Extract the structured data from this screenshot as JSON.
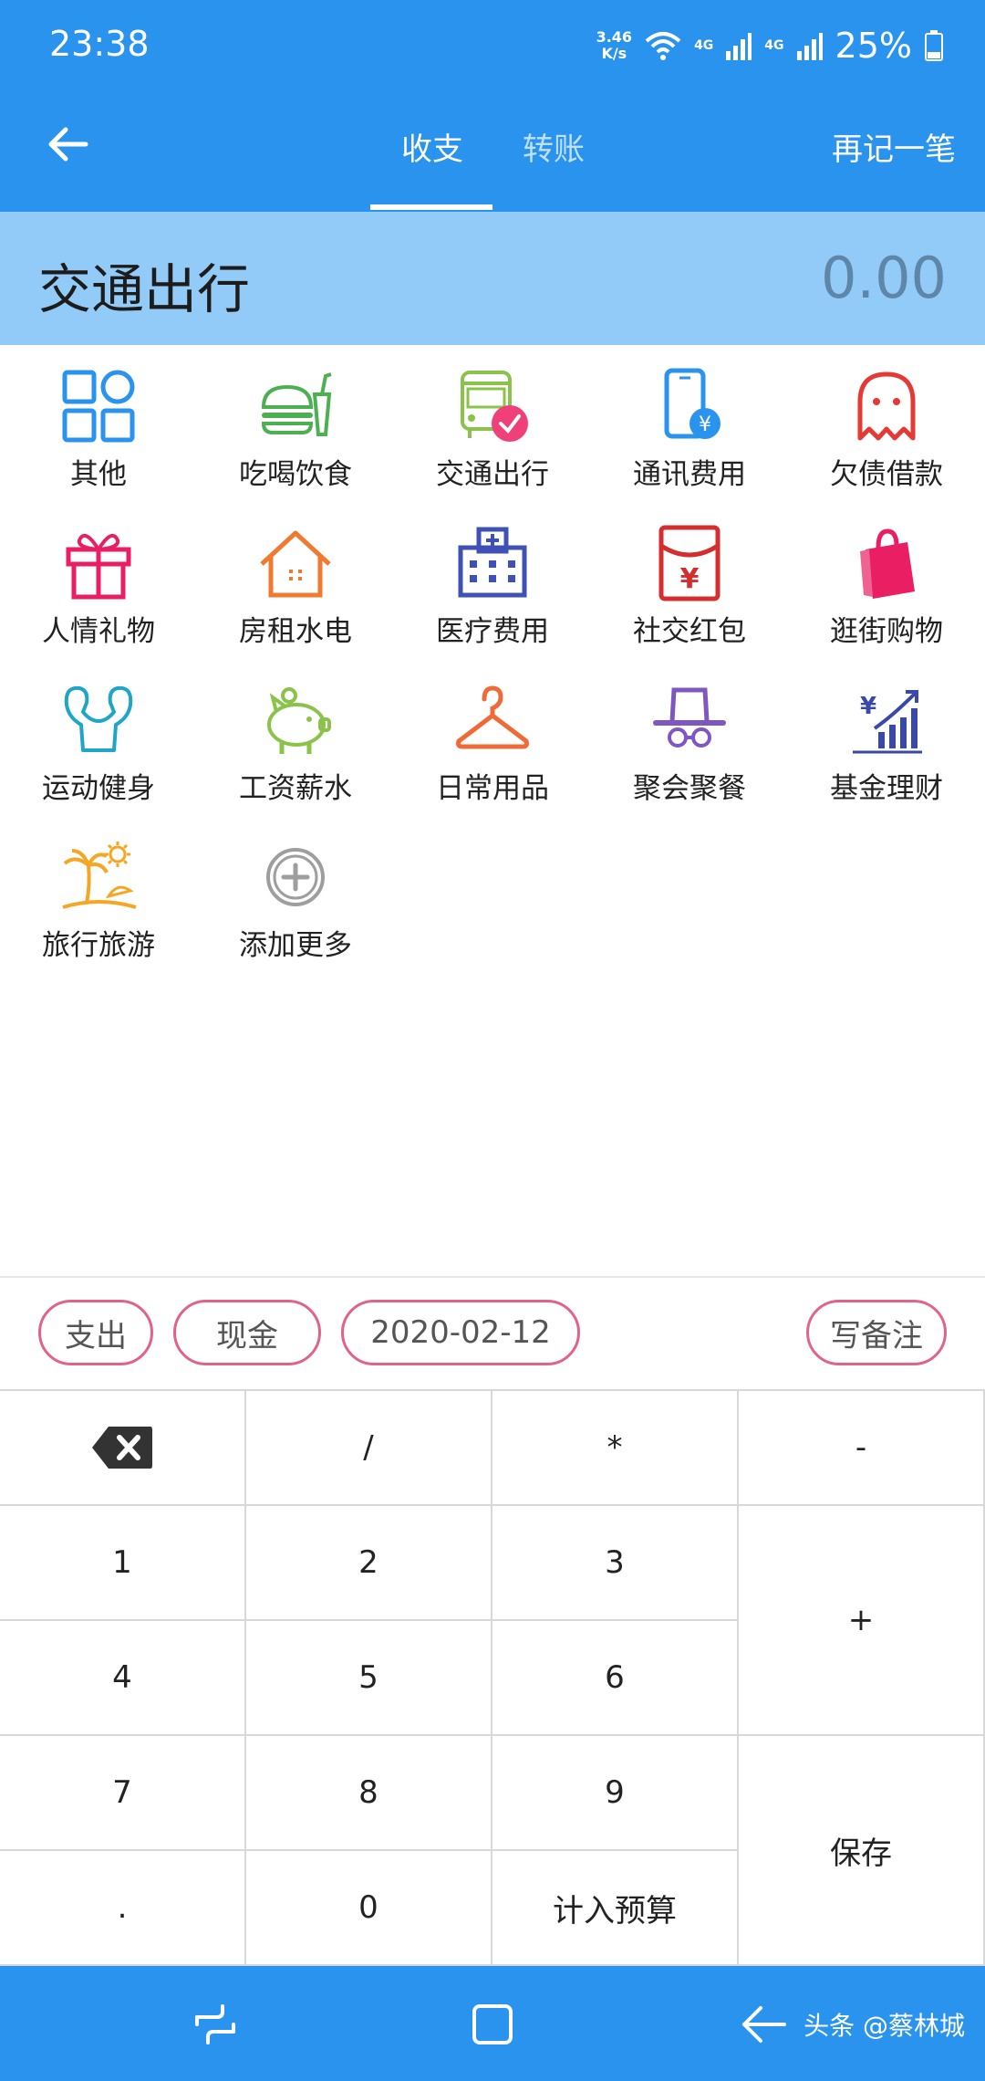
{
  "status": {
    "time": "23:38",
    "speed_top": "3.46",
    "speed_bottom": "K/s",
    "net1": "4G",
    "net2": "4G",
    "battery": "25%"
  },
  "appbar": {
    "tab_income_expense": "收支",
    "tab_transfer": "转账",
    "again": "再记一笔"
  },
  "category_bar": {
    "name": "交通出行",
    "amount": "0.00"
  },
  "categories": [
    {
      "label": "其他",
      "icon": "grid-icon"
    },
    {
      "label": "吃喝饮食",
      "icon": "burger-drink-icon"
    },
    {
      "label": "交通出行",
      "icon": "bus-icon"
    },
    {
      "label": "通讯费用",
      "icon": "phone-icon"
    },
    {
      "label": "欠债借款",
      "icon": "ghost-icon"
    },
    {
      "label": "人情礼物",
      "icon": "gift-icon"
    },
    {
      "label": "房租水电",
      "icon": "house-icon"
    },
    {
      "label": "医疗费用",
      "icon": "hospital-icon"
    },
    {
      "label": "社交红包",
      "icon": "red-envelope-icon"
    },
    {
      "label": "逛街购物",
      "icon": "shopping-bag-icon"
    },
    {
      "label": "运动健身",
      "icon": "muscle-icon"
    },
    {
      "label": "工资薪水",
      "icon": "piggy-bank-icon"
    },
    {
      "label": "日常用品",
      "icon": "hanger-icon"
    },
    {
      "label": "聚会聚餐",
      "icon": "hat-glasses-icon"
    },
    {
      "label": "基金理财",
      "icon": "finance-chart-icon"
    },
    {
      "label": "旅行旅游",
      "icon": "beach-icon"
    },
    {
      "label": "添加更多",
      "icon": "add-circle-icon"
    }
  ],
  "chips": {
    "type": "支出",
    "account": "现金",
    "date": "2020-02-12",
    "note": "写备注"
  },
  "keys": {
    "slash": "/",
    "star": "*",
    "minus": "-",
    "k1": "1",
    "k2": "2",
    "k3": "3",
    "plus": "+",
    "k4": "4",
    "k5": "5",
    "k6": "6",
    "k7": "7",
    "k8": "8",
    "k9": "9",
    "save": "保存",
    "dot": ".",
    "k0": "0",
    "budget": "计入预算"
  },
  "watermark": "头条 @蔡林城",
  "colors": {
    "primary": "#2a93ee",
    "category_bar": "#92cbf7",
    "chip_border": "#e0648a"
  }
}
